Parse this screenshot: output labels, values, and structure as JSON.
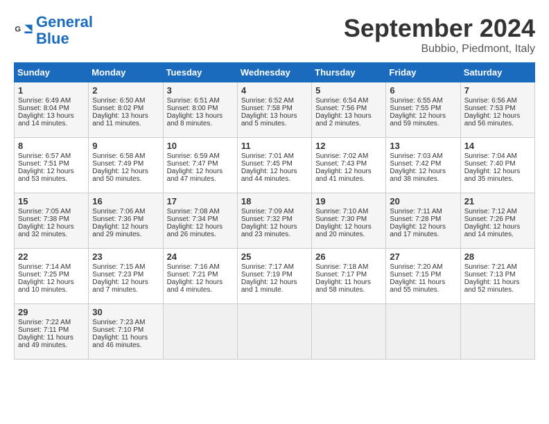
{
  "header": {
    "logo_general": "General",
    "logo_blue": "Blue",
    "month_title": "September 2024",
    "location": "Bubbio, Piedmont, Italy"
  },
  "weekdays": [
    "Sunday",
    "Monday",
    "Tuesday",
    "Wednesday",
    "Thursday",
    "Friday",
    "Saturday"
  ],
  "weeks": [
    [
      {
        "day": "1",
        "sunrise": "6:49 AM",
        "sunset": "8:04 PM",
        "daylight": "13 hours and 14 minutes."
      },
      {
        "day": "2",
        "sunrise": "6:50 AM",
        "sunset": "8:02 PM",
        "daylight": "13 hours and 11 minutes."
      },
      {
        "day": "3",
        "sunrise": "6:51 AM",
        "sunset": "8:00 PM",
        "daylight": "13 hours and 8 minutes."
      },
      {
        "day": "4",
        "sunrise": "6:52 AM",
        "sunset": "7:58 PM",
        "daylight": "13 hours and 5 minutes."
      },
      {
        "day": "5",
        "sunrise": "6:54 AM",
        "sunset": "7:56 PM",
        "daylight": "13 hours and 2 minutes."
      },
      {
        "day": "6",
        "sunrise": "6:55 AM",
        "sunset": "7:55 PM",
        "daylight": "12 hours and 59 minutes."
      },
      {
        "day": "7",
        "sunrise": "6:56 AM",
        "sunset": "7:53 PM",
        "daylight": "12 hours and 56 minutes."
      }
    ],
    [
      {
        "day": "8",
        "sunrise": "6:57 AM",
        "sunset": "7:51 PM",
        "daylight": "12 hours and 53 minutes."
      },
      {
        "day": "9",
        "sunrise": "6:58 AM",
        "sunset": "7:49 PM",
        "daylight": "12 hours and 50 minutes."
      },
      {
        "day": "10",
        "sunrise": "6:59 AM",
        "sunset": "7:47 PM",
        "daylight": "12 hours and 47 minutes."
      },
      {
        "day": "11",
        "sunrise": "7:01 AM",
        "sunset": "7:45 PM",
        "daylight": "12 hours and 44 minutes."
      },
      {
        "day": "12",
        "sunrise": "7:02 AM",
        "sunset": "7:43 PM",
        "daylight": "12 hours and 41 minutes."
      },
      {
        "day": "13",
        "sunrise": "7:03 AM",
        "sunset": "7:42 PM",
        "daylight": "12 hours and 38 minutes."
      },
      {
        "day": "14",
        "sunrise": "7:04 AM",
        "sunset": "7:40 PM",
        "daylight": "12 hours and 35 minutes."
      }
    ],
    [
      {
        "day": "15",
        "sunrise": "7:05 AM",
        "sunset": "7:38 PM",
        "daylight": "12 hours and 32 minutes."
      },
      {
        "day": "16",
        "sunrise": "7:06 AM",
        "sunset": "7:36 PM",
        "daylight": "12 hours and 29 minutes."
      },
      {
        "day": "17",
        "sunrise": "7:08 AM",
        "sunset": "7:34 PM",
        "daylight": "12 hours and 26 minutes."
      },
      {
        "day": "18",
        "sunrise": "7:09 AM",
        "sunset": "7:32 PM",
        "daylight": "12 hours and 23 minutes."
      },
      {
        "day": "19",
        "sunrise": "7:10 AM",
        "sunset": "7:30 PM",
        "daylight": "12 hours and 20 minutes."
      },
      {
        "day": "20",
        "sunrise": "7:11 AM",
        "sunset": "7:28 PM",
        "daylight": "12 hours and 17 minutes."
      },
      {
        "day": "21",
        "sunrise": "7:12 AM",
        "sunset": "7:26 PM",
        "daylight": "12 hours and 14 minutes."
      }
    ],
    [
      {
        "day": "22",
        "sunrise": "7:14 AM",
        "sunset": "7:25 PM",
        "daylight": "12 hours and 10 minutes."
      },
      {
        "day": "23",
        "sunrise": "7:15 AM",
        "sunset": "7:23 PM",
        "daylight": "12 hours and 7 minutes."
      },
      {
        "day": "24",
        "sunrise": "7:16 AM",
        "sunset": "7:21 PM",
        "daylight": "12 hours and 4 minutes."
      },
      {
        "day": "25",
        "sunrise": "7:17 AM",
        "sunset": "7:19 PM",
        "daylight": "12 hours and 1 minute."
      },
      {
        "day": "26",
        "sunrise": "7:18 AM",
        "sunset": "7:17 PM",
        "daylight": "11 hours and 58 minutes."
      },
      {
        "day": "27",
        "sunrise": "7:20 AM",
        "sunset": "7:15 PM",
        "daylight": "11 hours and 55 minutes."
      },
      {
        "day": "28",
        "sunrise": "7:21 AM",
        "sunset": "7:13 PM",
        "daylight": "11 hours and 52 minutes."
      }
    ],
    [
      {
        "day": "29",
        "sunrise": "7:22 AM",
        "sunset": "7:11 PM",
        "daylight": "11 hours and 49 minutes."
      },
      {
        "day": "30",
        "sunrise": "7:23 AM",
        "sunset": "7:10 PM",
        "daylight": "11 hours and 46 minutes."
      },
      null,
      null,
      null,
      null,
      null
    ]
  ]
}
